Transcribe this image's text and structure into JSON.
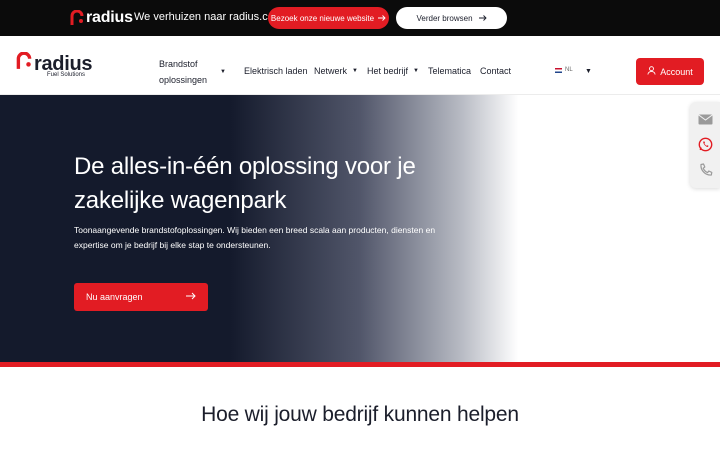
{
  "topbar": {
    "logo_text": "radius",
    "message": "We verhuizen naar radius.com",
    "new_site_button": "Bezoek onze nieuwe website",
    "continue_button": "Verder browsen"
  },
  "nav": {
    "brand_name": "radius",
    "brand_sub": "Fuel Solutions",
    "items": [
      {
        "label": "Brandstof oplossingen",
        "dropdown": true
      },
      {
        "label": "Elektrisch laden",
        "dropdown": false
      },
      {
        "label": "Netwerk",
        "dropdown": true
      },
      {
        "label": "Het bedrijf",
        "dropdown": true
      },
      {
        "label": "Telematica",
        "dropdown": false
      },
      {
        "label": "Contact",
        "dropdown": false
      }
    ],
    "language": "NL",
    "account_button": "Account"
  },
  "hero": {
    "title": "De alles-in-één oplossing voor je zakelijke wagenpark",
    "text": "Toonaangevende brandstofoplossingen. Wij bieden een breed scala aan producten, diensten en expertise om je bedrijf bij elke stap te ondersteunen.",
    "cta": "Nu aanvragen"
  },
  "contact_widget": {
    "icons": [
      "mail-icon",
      "whatsapp-icon",
      "phone-icon"
    ]
  },
  "section": {
    "title": "Hoe wij jouw bedrijf kunnen helpen"
  },
  "colors": {
    "brand_red": "#e21c23",
    "dark_navy": "#141a2c",
    "topbar_black": "#0b0b0b"
  }
}
